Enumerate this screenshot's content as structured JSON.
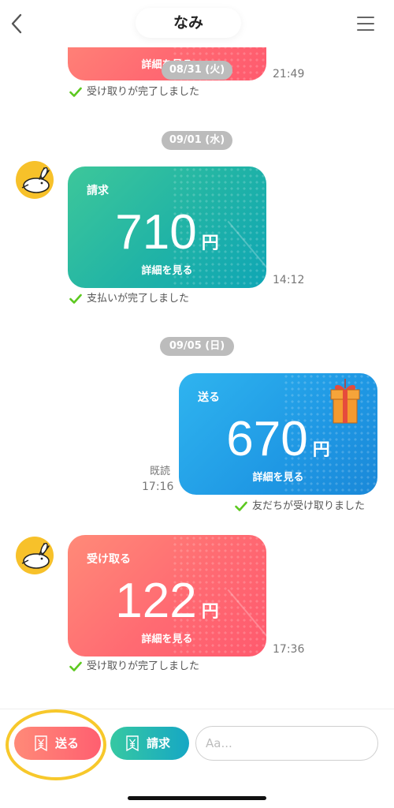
{
  "header": {
    "title": "なみ"
  },
  "messages": {
    "top": {
      "detail": "詳細を見る",
      "time": "21:49",
      "status": "受け取りが完了しました"
    },
    "m1": {
      "type": "請求",
      "amount": "710",
      "unit": "円",
      "detail": "詳細を見る",
      "time": "14:12",
      "status": "支払いが完了しました"
    },
    "m2": {
      "type": "送る",
      "amount": "670",
      "unit": "円",
      "detail": "詳細を見る",
      "time": "17:16",
      "read": "既読",
      "status": "友だちが受け取りました"
    },
    "m3": {
      "type": "受け取る",
      "amount": "122",
      "unit": "円",
      "detail": "詳細を見る",
      "time": "17:36",
      "status": "受け取りが完了しました"
    }
  },
  "dates": {
    "d1": "08/31 (火)",
    "d2": "09/01 (水)",
    "d3": "09/05 (日)"
  },
  "bottom": {
    "send_label": "送る",
    "request_label": "請求",
    "input_placeholder": "Aa..."
  },
  "colors": {
    "accent_green": "#20b3a6",
    "accent_blue": "#1f98e4",
    "accent_red": "#ff6a72",
    "check_green": "#5cc81f",
    "highlight": "#f7c82b"
  },
  "icons": {
    "back": "chevron-left-icon",
    "menu": "hamburger-menu-icon",
    "yen": "yen-icon",
    "gift": "gift-icon",
    "check": "check-icon"
  }
}
